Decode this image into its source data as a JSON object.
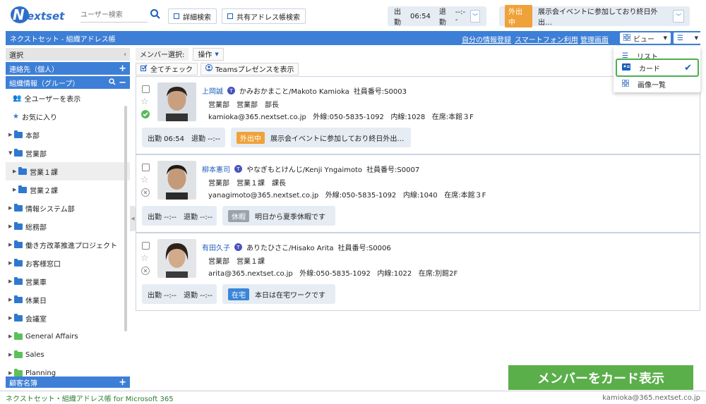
{
  "logo": {
    "text": "Nextset"
  },
  "topbar": {
    "search_placeholder": "ユーザー検索",
    "advanced_search": "詳細検索",
    "shared_search": "共有アドレス帳検索",
    "attendance": {
      "in_label": "出勤",
      "in_time": "06:54",
      "out_label": "退勤",
      "out_time": "--:--"
    },
    "status": {
      "badge": "外出中",
      "text": "展示会イベントに参加しており終日外出…"
    }
  },
  "header": {
    "title": "ネクストセット - 組織アドレス帳",
    "link1": "自分の情報登録",
    "link2": "スマートフォン利用",
    "link3": "管理画面",
    "view_label": "ビュー"
  },
  "view_menu": {
    "items": [
      "リスト",
      "カード",
      "画像一覧"
    ],
    "selected": "カード"
  },
  "sidebar": {
    "select_label": "選択",
    "contacts_label": "連絡先（個人）",
    "org_label": "組織情報（グループ）",
    "show_all": "全ユーザーを表示",
    "favorites": "お気に入り",
    "tree": [
      "本部",
      "営業部",
      "営業１課",
      "営業２課",
      "情報システム部",
      "総務部",
      "働き方改革推進プロジェクト",
      "お客様窓口",
      "営業車",
      "休業日",
      "会議室",
      "General Affairs",
      "Sales",
      "Planning"
    ],
    "customers_label": "顧客名簿"
  },
  "toolbar": {
    "member_select": "メンバー選択:",
    "operation": "操作",
    "check_all": "全てチェック",
    "teams_presence": "Teamsプレゼンスを表示"
  },
  "members": [
    {
      "name": "上岡誠",
      "reading": "かみおかまこと/Makoto Kamioka",
      "employee_no": "社員番号:S0003",
      "dept": "営業部　営業部　部長",
      "email": "kamioka@365.nextset.co.jp",
      "ext": "外線:050-5835-1092",
      "inner": "内線:1028",
      "seat": "在席:本館３F",
      "att": "出勤 06:54　退勤 --:--",
      "badge": "外出中",
      "status_text": "展示会イベントに参加しており終日外出…",
      "badge_color": "#f0a23a"
    },
    {
      "name": "柳本憲司",
      "reading": "やなぎもとけんじ/Kenji Yngaimoto",
      "employee_no": "社員番号:S0007",
      "dept": "営業部　営業１課　課長",
      "email": "yanagimoto@365.nextset.co.jp",
      "ext": "外線:050-5835-1092",
      "inner": "内線:1040",
      "seat": "在席:本館３F",
      "att": "出勤 --:--　退勤 --:--",
      "badge": "休暇",
      "status_text": "明日から夏季休暇です",
      "badge_color": "#9aa3ad"
    },
    {
      "name": "有田久子",
      "reading": "ありたひさこ/Hisako Arita",
      "employee_no": "社員番号:S0006",
      "dept": "営業部　営業１課",
      "email": "arita@365.nextset.co.jp",
      "ext": "外線:050-5835-1092",
      "inner": "内線:1022",
      "seat": "在席:別館2F",
      "att": "出勤 --:--　退勤 --:--",
      "badge": "在宅",
      "status_text": "本日は在宅ワークです",
      "badge_color": "#3b86d8"
    }
  ],
  "footer": {
    "left": "ネクストセット・組織アドレス帳 for Microsoft 365",
    "right": "kamioka@365.nextset.co.jp"
  },
  "overlay": {
    "text": "メンバーをカード表示"
  }
}
